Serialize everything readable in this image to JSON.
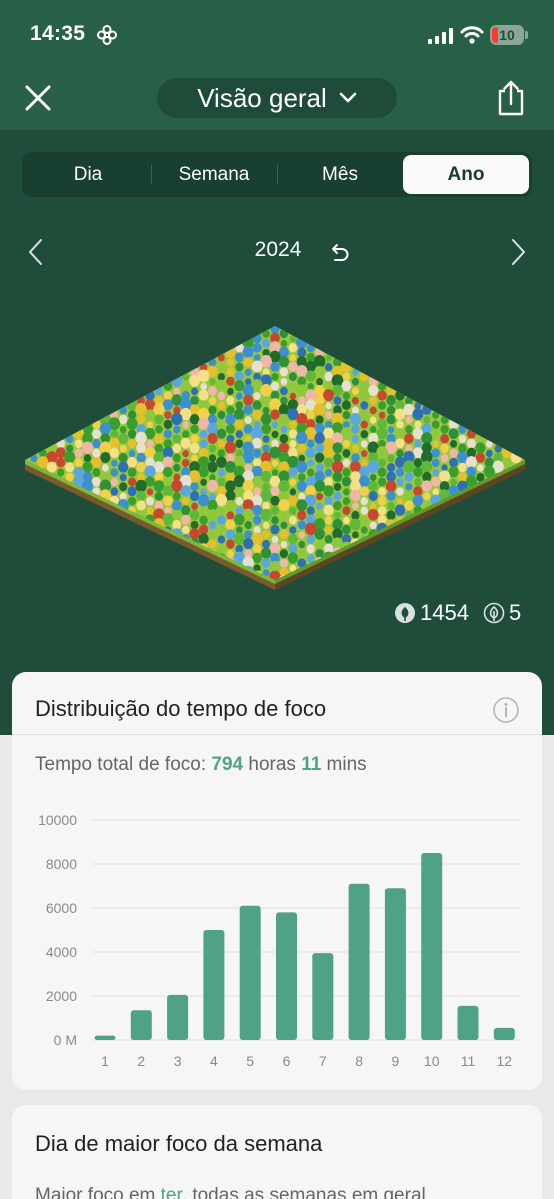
{
  "status_bar": {
    "time": "14:35",
    "battery_level": "10"
  },
  "header": {
    "title": "Visão geral"
  },
  "tabs": [
    {
      "label": "Dia",
      "active": false
    },
    {
      "label": "Semana",
      "active": false
    },
    {
      "label": "Mês",
      "active": false
    },
    {
      "label": "Ano",
      "active": true
    }
  ],
  "period": {
    "year": "2024"
  },
  "forest_stats": {
    "trees": "1454",
    "dead_trees": "5"
  },
  "focus_card": {
    "title": "Distribuição do tempo de foco",
    "total_prefix": "Tempo total de foco: ",
    "hours": "794",
    "hours_unit": " horas ",
    "mins": "11",
    "mins_unit": " mins"
  },
  "chart_data": {
    "type": "bar",
    "categories": [
      "1",
      "2",
      "3",
      "4",
      "5",
      "6",
      "7",
      "8",
      "9",
      "10",
      "11",
      "12"
    ],
    "values": [
      200,
      1350,
      2050,
      5000,
      6100,
      5800,
      3950,
      7100,
      6900,
      8500,
      1550,
      550
    ],
    "ylim": [
      0,
      10000
    ],
    "yticks": [
      "0 M",
      "2000",
      "4000",
      "6000",
      "8000",
      "10000"
    ],
    "ytick_values": [
      0,
      2000,
      4000,
      6000,
      8000,
      10000
    ],
    "grid": true,
    "bar_color": "#4fa384"
  },
  "weekday_card": {
    "title": "Dia de maior foco da semana",
    "sub_prefix": "Maior foco em ",
    "day": "ter",
    "sub_suffix": ", todas as semanas em geral"
  },
  "colors": {
    "header": "#285f47",
    "background": "#1f4d3a",
    "accent": "#4da583"
  }
}
